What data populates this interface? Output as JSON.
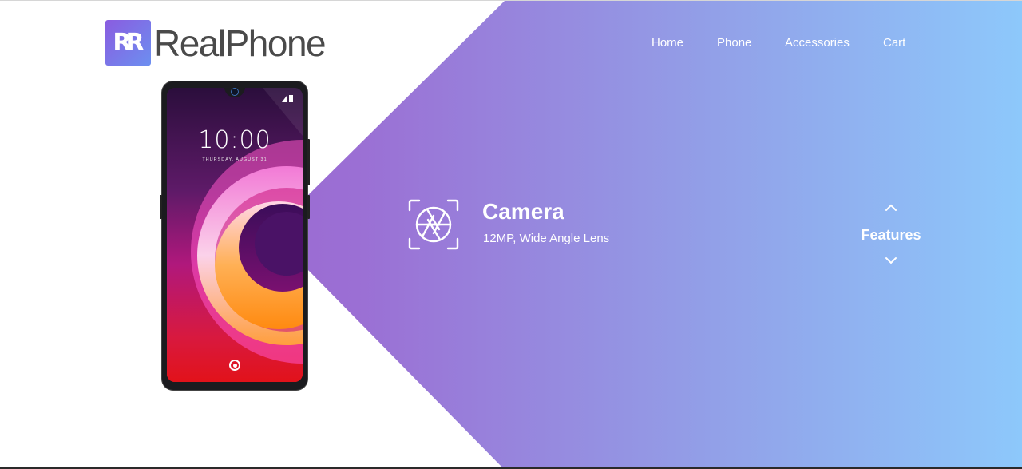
{
  "brand": {
    "logo_mark": "RR",
    "name": "RealPhone"
  },
  "nav": {
    "items": [
      {
        "label": "Home"
      },
      {
        "label": "Phone"
      },
      {
        "label": "Accessories"
      },
      {
        "label": "Cart"
      }
    ]
  },
  "phone": {
    "clock": "10:00",
    "date": "Thursday, August 31"
  },
  "feature": {
    "icon": "camera-aperture-icon",
    "title": "Camera",
    "description": "12MP, Wide Angle Lens"
  },
  "features_switcher": {
    "label": "Features",
    "up_icon": "chevron-up-icon",
    "down_icon": "chevron-down-icon"
  },
  "colors": {
    "gradient_start": "#9a5fcc",
    "gradient_end": "#8dc8fb",
    "logo_text": "#4a4a4a"
  }
}
